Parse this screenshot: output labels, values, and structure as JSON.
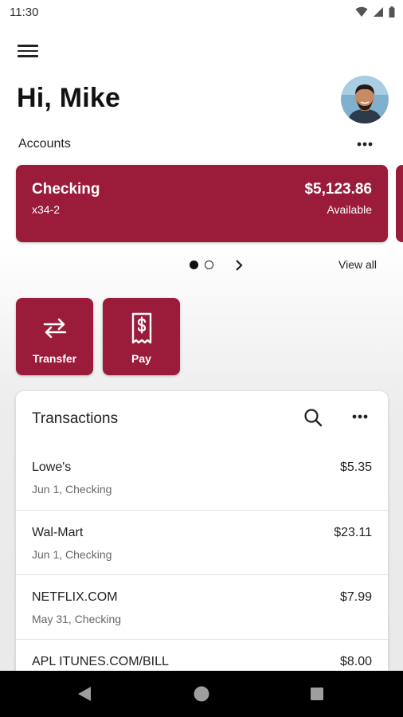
{
  "status_bar": {
    "time": "11:30"
  },
  "header": {
    "greeting": "Hi, Mike"
  },
  "accounts": {
    "label": "Accounts",
    "cards": [
      {
        "name": "Checking",
        "number": "x34-2",
        "balance": "$5,123.86",
        "balance_label": "Available"
      }
    ],
    "view_all": "View all"
  },
  "actions": [
    {
      "label": "Transfer",
      "icon": "transfer-arrows-icon"
    },
    {
      "label": "Pay",
      "icon": "receipt-dollar-icon"
    }
  ],
  "transactions": {
    "title": "Transactions",
    "items": [
      {
        "name": "Lowe's",
        "meta": "Jun 1, Checking",
        "amount": "$5.35"
      },
      {
        "name": "Wal-Mart",
        "meta": "Jun 1, Checking",
        "amount": "$23.11"
      },
      {
        "name": "NETFLIX.COM",
        "meta": "May 31, Checking",
        "amount": "$7.99"
      },
      {
        "name": "APL ITUNES.COM/BILL",
        "meta": "",
        "amount": "$8.00"
      }
    ]
  },
  "colors": {
    "brand": "#9b1b3a",
    "nav_bar": "#000000"
  }
}
